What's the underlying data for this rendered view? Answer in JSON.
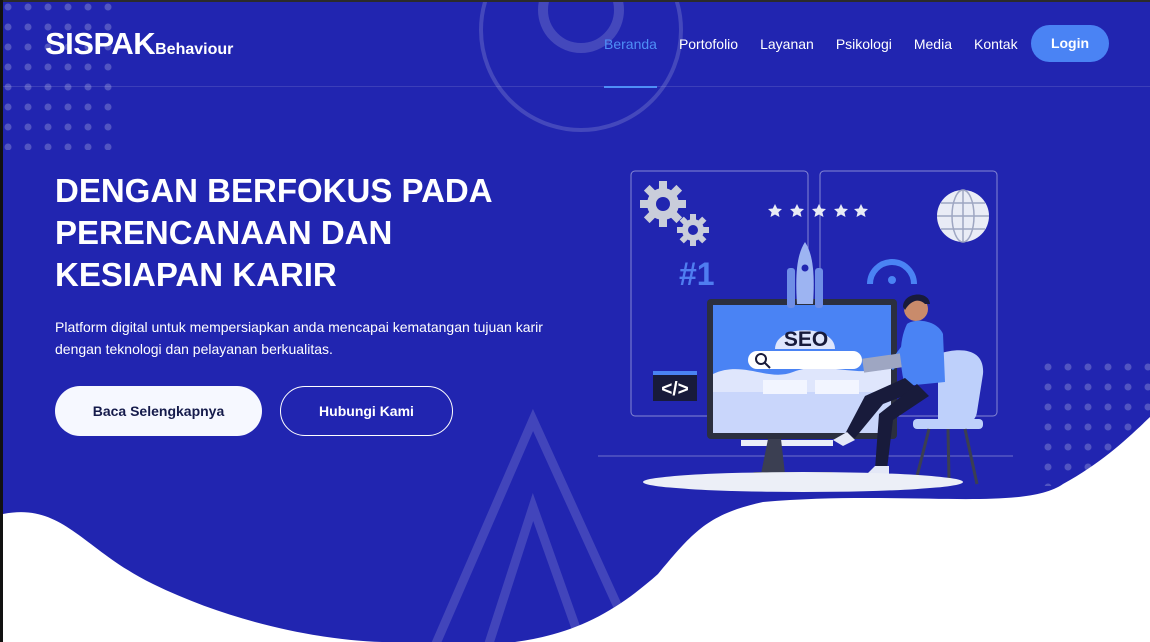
{
  "brand": {
    "name": "SISPAK",
    "suffix": "Behaviour"
  },
  "nav": {
    "items": [
      {
        "label": "Beranda",
        "active": true
      },
      {
        "label": "Portofolio",
        "active": false
      },
      {
        "label": "Layanan",
        "active": false
      },
      {
        "label": "Psikologi",
        "active": false
      },
      {
        "label": "Media",
        "active": false
      },
      {
        "label": "Kontak",
        "active": false
      }
    ],
    "login_label": "Login"
  },
  "hero": {
    "headline": "DENGAN BERFOKUS PADA PERENCANAAN DAN KESIAPAN KARIR",
    "subtext": "Platform digital untuk mempersiapkan anda mencapai kematangan tujuan karir dengan teknologi dan pelayanan berkualitas.",
    "primary_button": "Baca Selengkapnya",
    "secondary_button": "Hubungi Kami"
  },
  "illustration": {
    "rank_text": "#1",
    "seo_text": "SEO",
    "code_text": "</>",
    "stars": 5,
    "icons": [
      "gear-icon",
      "star-icon",
      "globe-icon",
      "search-icon",
      "rocket-icon",
      "code-icon"
    ]
  },
  "colors": {
    "hero_background": "#2125b0",
    "accent": "#4a83f4",
    "active_nav": "#4f8ff7",
    "wave": "#ffffff"
  }
}
